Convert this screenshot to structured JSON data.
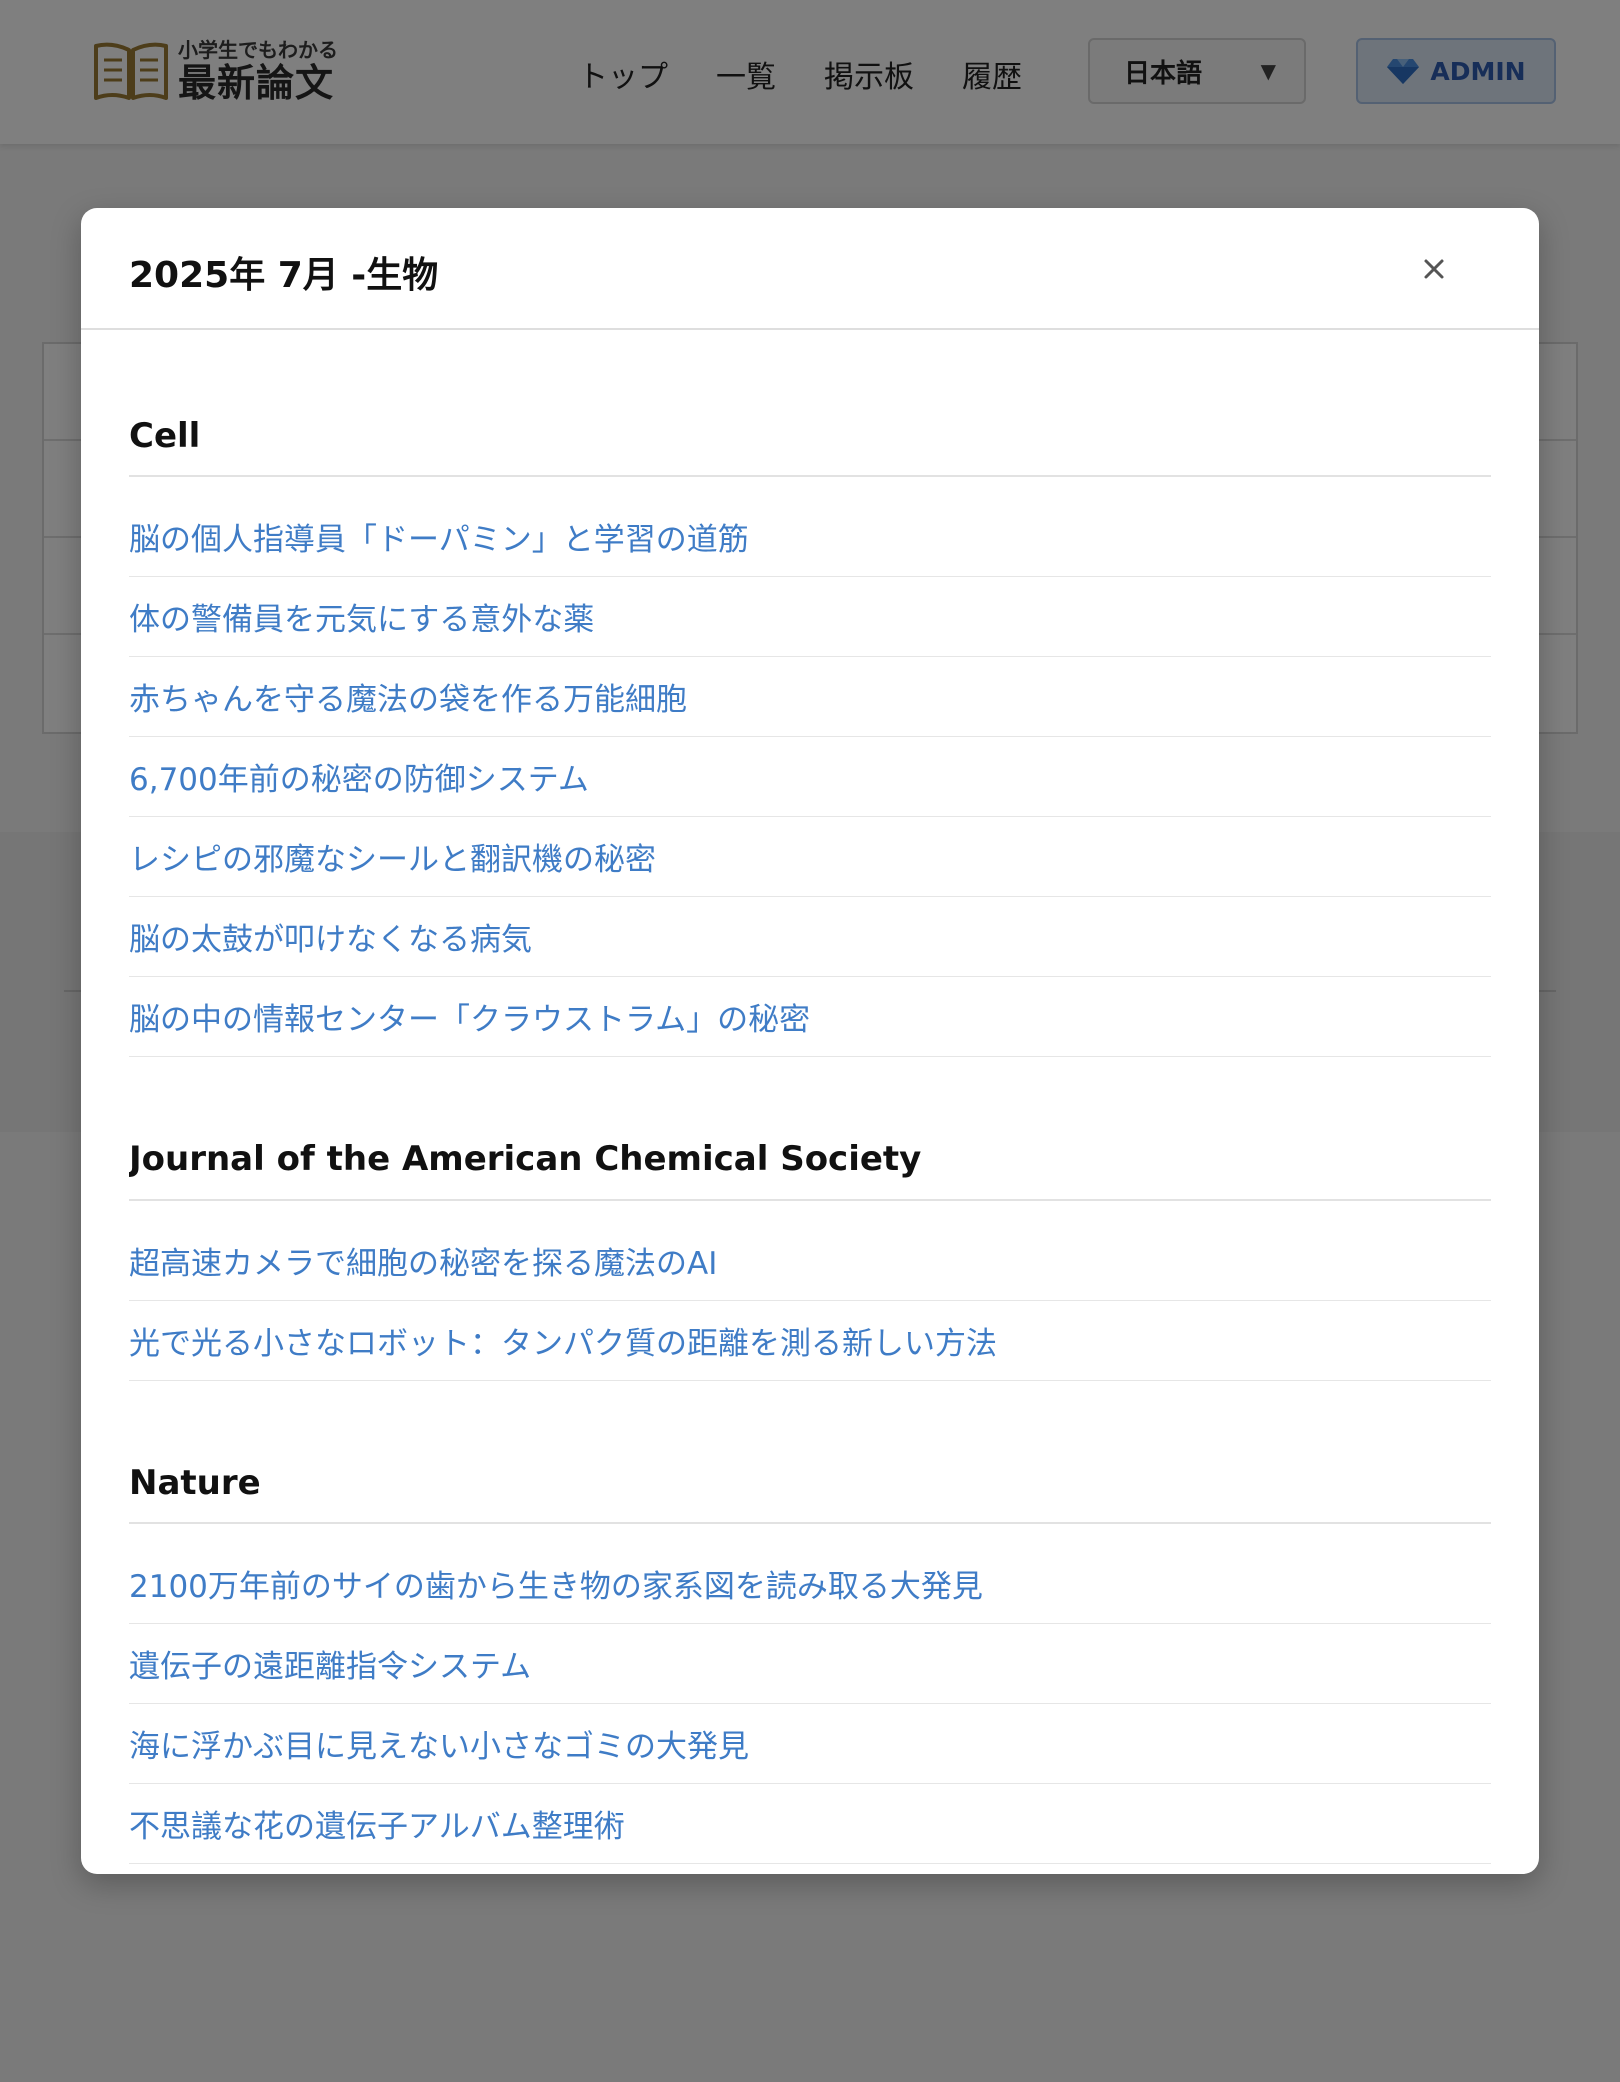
{
  "header": {
    "logo_sub": "小学生でもわかる",
    "logo_main": "最新論文",
    "nav": [
      "トップ",
      "一覧",
      "掲示板",
      "履歴"
    ],
    "language": "日本語",
    "admin_label": "ADMIN"
  },
  "modal": {
    "title": "2025年 7月 -生物",
    "journals": [
      {
        "name": "Cell",
        "articles": [
          "脳の個人指導員「ドーパミン」と学習の道筋",
          "体の警備員を元気にする意外な薬",
          "赤ちゃんを守る魔法の袋を作る万能細胞",
          "6,700年前の秘密の防御システム",
          "レシピの邪魔なシールと翻訳機の秘密",
          "脳の太鼓が叩けなくなる病気",
          "脳の中の情報センター「クラウストラム」の秘密"
        ]
      },
      {
        "name": "Journal of the American Chemical Society",
        "articles": [
          "超高速カメラで細胞の秘密を探る魔法のAI",
          "光で光る小さなロボット：タンパク質の距離を測る新しい方法"
        ]
      },
      {
        "name": "Nature",
        "articles": [
          "2100万年前のサイの歯から生き物の家系図を読み取る大発見",
          "遺伝子の遠距離指令システム",
          "海に浮かぶ目に見えない小さなゴミの大発見",
          "不思議な花の遺伝子アルバム整理術"
        ]
      }
    ]
  },
  "colors": {
    "link": "#3f7cc6",
    "overlay": "rgba(0,0,0,0.5)",
    "admin_bg": "#dce8f7",
    "admin_text": "#2f5db0",
    "logo_gold": "#9a7b35"
  },
  "icons": {
    "logo": "open-book-icon",
    "admin": "diamond-icon",
    "close": "close-icon",
    "dropdown": "chevron-down-icon"
  }
}
